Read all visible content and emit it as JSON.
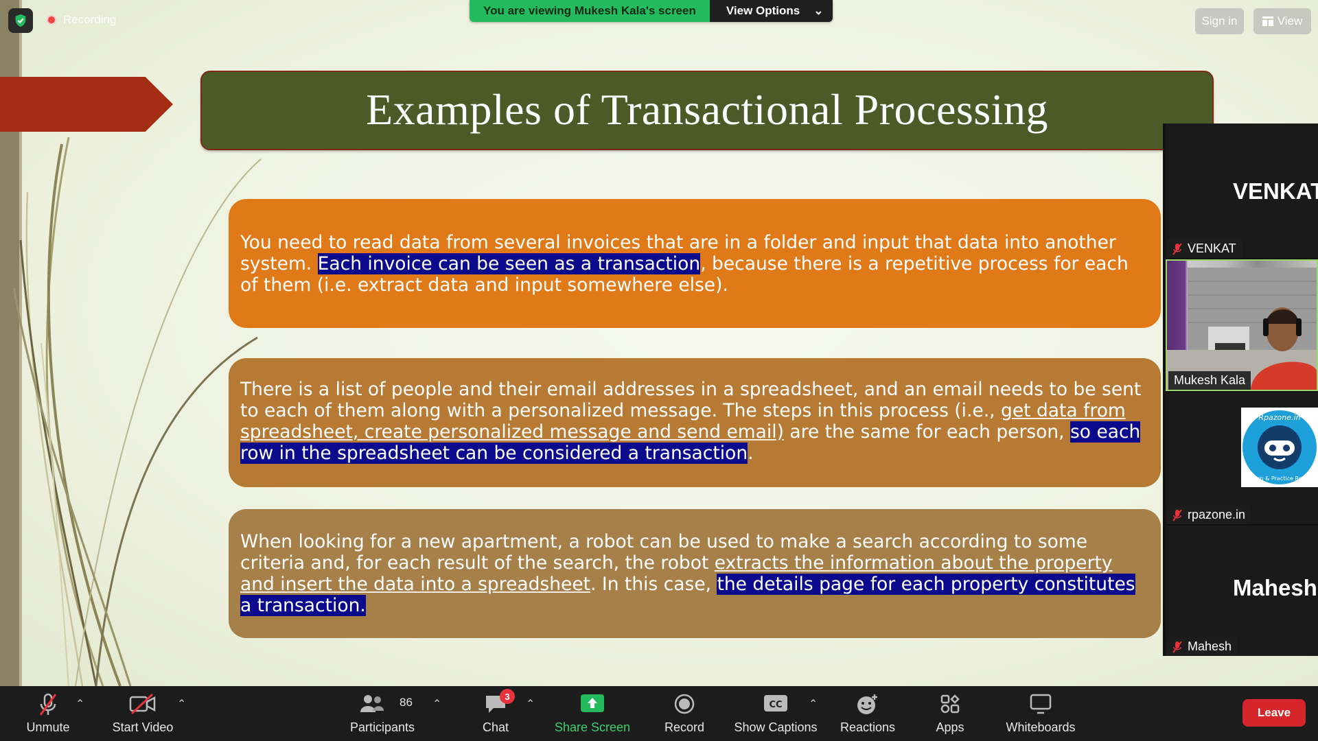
{
  "topbar": {
    "recording_label": "Recording",
    "viewing_label": "You are viewing Mukesh Kala's screen",
    "view_options_label": "View Options",
    "sign_in_label": "Sign in",
    "view_label": "View"
  },
  "slide": {
    "title": "Examples of Transactional Processing",
    "card1": {
      "text_a": "You need to read data from several invoices that are in a folder and input that data into another system. ",
      "highlight": "Each invoice can be seen as a transaction",
      "text_b": ", because there is a repetitive process for each of them (i.e.  extract data and input somewhere else)."
    },
    "card2": {
      "text_a": "There is a list of people and their email addresses in a spreadsheet, and an email needs to be sent to each of them along with a personalized message. The steps in this process (i.e., ",
      "underlined": "get data from spreadsheet, create personalized message and send email)",
      "text_b": " are the same for each person, ",
      "highlight": "so each row in the spreadsheet can be considered a transaction",
      "text_c": "."
    },
    "card3": {
      "text_a": "When looking for a new apartment, a robot can be used to make a search according to some criteria and, for each result of the search, the robot ",
      "underlined_1": "extracts the information about the property",
      "underlined_2": "and insert the data into a spreadsheet",
      "text_b": ". In this case, ",
      "highlight": "the details page for each property constitutes a transaction."
    }
  },
  "gallery": {
    "tiles": [
      {
        "big_name": "VENKAT",
        "label": "VENKAT"
      },
      {
        "label": "Mukesh Kala"
      },
      {
        "label": "rpazone.in",
        "logo_text_top": "Rpazone.in",
        "logo_text_bottom": "Learn & Practice Rocks"
      },
      {
        "big_name": "Mahesh",
        "label": "Mahesh"
      }
    ]
  },
  "toolbar": {
    "unmute": "Unmute",
    "start_video": "Start Video",
    "participants": "Participants",
    "participants_count": "86",
    "chat": "Chat",
    "chat_badge": "3",
    "share_screen": "Share Screen",
    "record": "Record",
    "show_captions": "Show Captions",
    "captions_icon_text": "CC",
    "reactions": "Reactions",
    "apps": "Apps",
    "whiteboards": "Whiteboards",
    "leave": "Leave"
  },
  "colors": {
    "title_bg": "#4b5a27",
    "card1_bg": "#e07a19",
    "card2_bg": "#b67a34",
    "card3_bg": "#a78049",
    "highlight": "#0b0a8c",
    "share_green": "#23bb5d",
    "leave_red": "#d6252b"
  }
}
